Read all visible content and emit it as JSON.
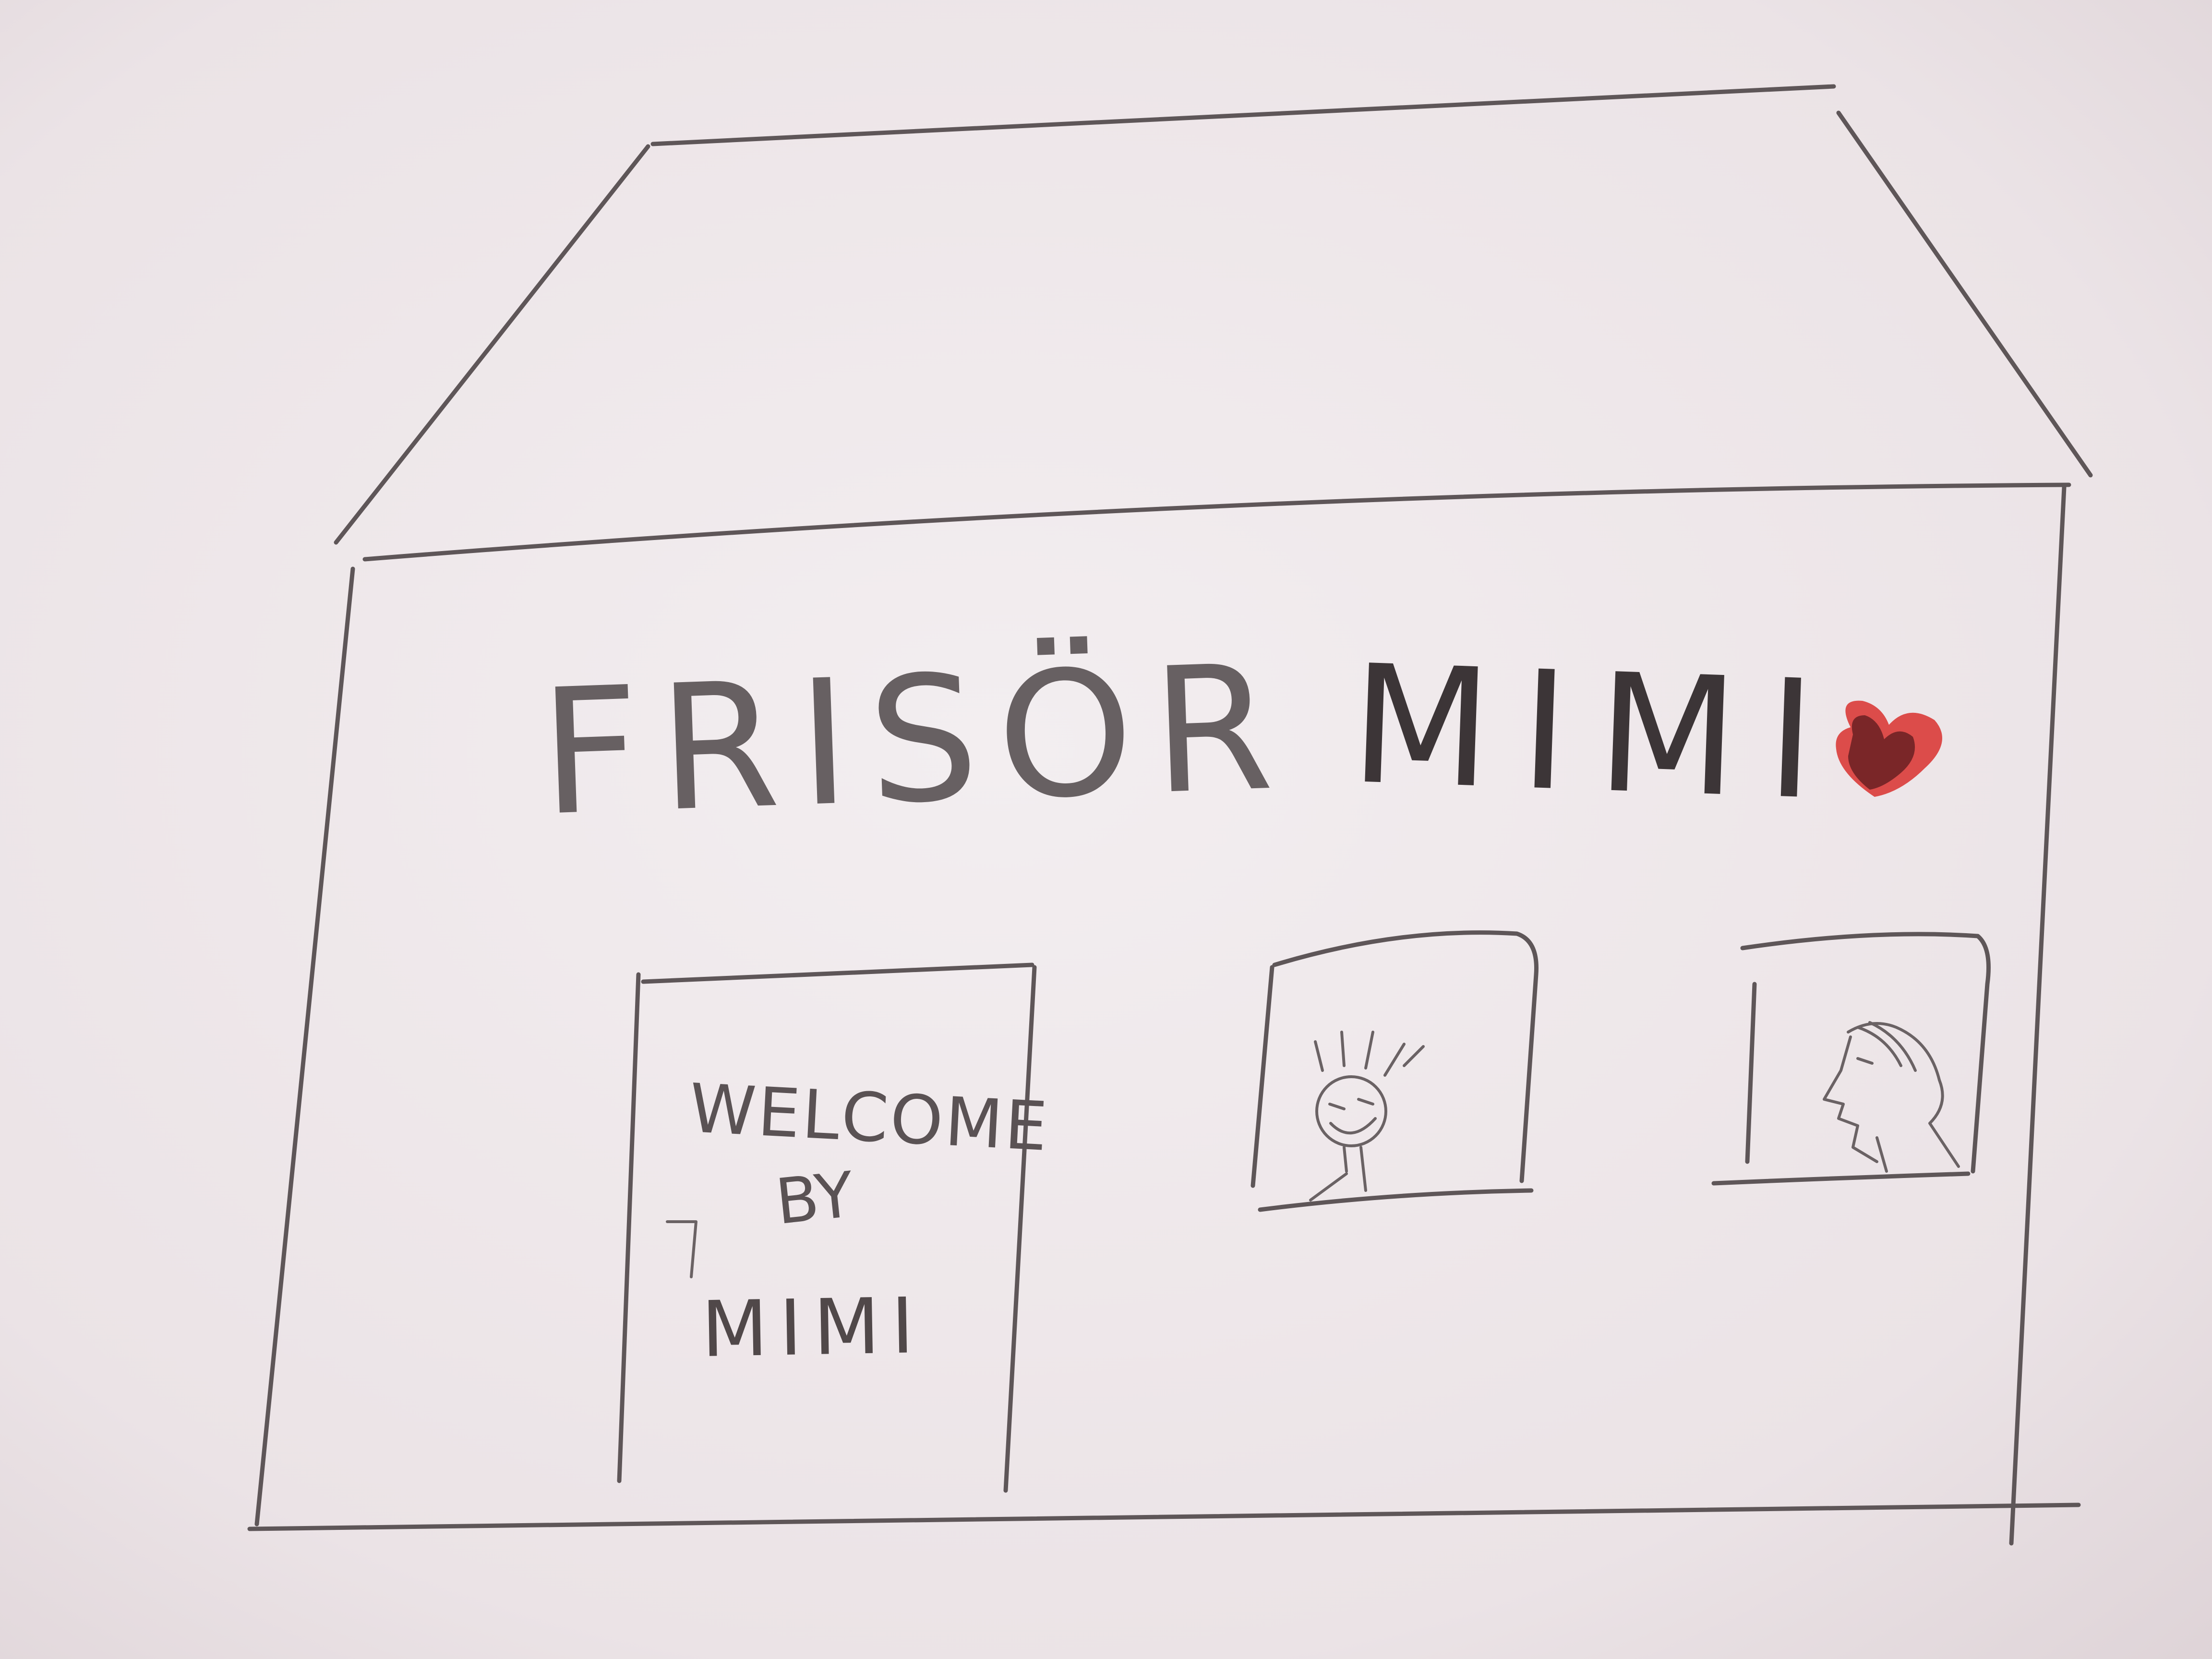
{
  "drawing": {
    "sign_left": "FRISÖR",
    "sign_right": "MIMI",
    "door_text": {
      "line1": "WELCOME",
      "line2": "BY",
      "line3": "MIMI"
    }
  },
  "colors": {
    "paper": "#ece4e7",
    "pencil": "#5e5658",
    "heart_red": "#d8302e",
    "heart_dark": "#5a1a1e"
  },
  "icons": [
    "house-outline",
    "roof",
    "door",
    "window",
    "smiling-face",
    "profile-face",
    "heart-icon"
  ]
}
